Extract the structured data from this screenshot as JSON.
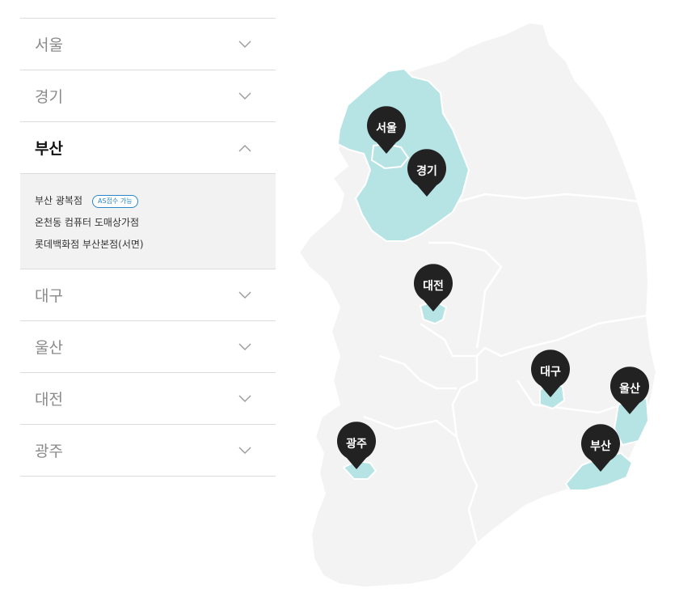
{
  "accordion": {
    "items": [
      {
        "label": "서울",
        "open": false
      },
      {
        "label": "경기",
        "open": false
      },
      {
        "label": "부산",
        "open": true,
        "stores": [
          {
            "name": "부산 광복점",
            "badge": "AS접수 가능"
          },
          {
            "name": "온천동 컴퓨터 도매상가점",
            "badge": ""
          },
          {
            "name": "롯데백화점 부산본점(서면)",
            "badge": ""
          }
        ]
      },
      {
        "label": "대구",
        "open": false
      },
      {
        "label": "울산",
        "open": false
      },
      {
        "label": "대전",
        "open": false
      },
      {
        "label": "광주",
        "open": false
      }
    ]
  },
  "map": {
    "pins": {
      "seoul": "서울",
      "gyeonggi": "경기",
      "daejeon": "대전",
      "daegu": "대구",
      "ulsan": "울산",
      "busan": "부산",
      "gwangju": "광주"
    },
    "colors": {
      "land": "#f3f3f3",
      "highlight": "#b6e3e4",
      "pin": "#222222",
      "border": "#ffffff"
    }
  }
}
